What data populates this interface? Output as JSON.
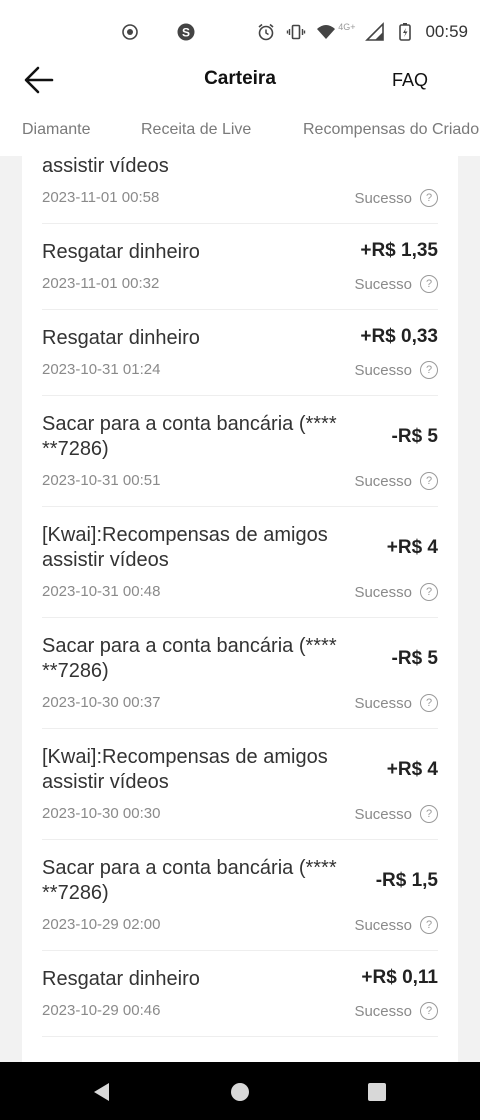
{
  "status_bar": {
    "time": "00:59",
    "network": "4G+",
    "icons": [
      "record-icon",
      "s-app-icon",
      "alarm-icon",
      "vibrate-icon",
      "wifi-icon",
      "signal-icon",
      "battery-icon"
    ]
  },
  "header": {
    "title": "Carteira",
    "faq": "FAQ"
  },
  "tabs": [
    {
      "label": "Diamante"
    },
    {
      "label": "Receita de Live"
    },
    {
      "label": "Recompensas do Criador"
    }
  ],
  "partial_top": {
    "desc": "assistir vídeos",
    "date": "2023-11-01 00:58",
    "status": "Sucesso"
  },
  "transactions": [
    {
      "desc": "Resgatar dinheiro",
      "amount": "+R$ 1,35",
      "date": "2023-11-01 00:32",
      "status": "Sucesso"
    },
    {
      "desc": "Resgatar dinheiro",
      "amount": "+R$ 0,33",
      "date": "2023-10-31 01:24",
      "status": "Sucesso"
    },
    {
      "desc": "Sacar para a conta bancária (****\n**7286)",
      "amount": "-R$ 5",
      "date": "2023-10-31 00:51",
      "status": "Sucesso"
    },
    {
      "desc": "[Kwai]:Recompensas de amigos\nassistir vídeos",
      "amount": "+R$ 4",
      "date": "2023-10-31 00:48",
      "status": "Sucesso"
    },
    {
      "desc": "Sacar para a conta bancária (****\n**7286)",
      "amount": "-R$ 5",
      "date": "2023-10-30 00:37",
      "status": "Sucesso"
    },
    {
      "desc": "[Kwai]:Recompensas de amigos\nassistir vídeos",
      "amount": "+R$ 4",
      "date": "2023-10-30 00:30",
      "status": "Sucesso"
    },
    {
      "desc": "Sacar para a conta bancária (****\n**7286)",
      "amount": "-R$ 1,5",
      "date": "2023-10-29 02:00",
      "status": "Sucesso"
    },
    {
      "desc": "Resgatar dinheiro",
      "amount": "+R$ 0,11",
      "date": "2023-10-29 00:46",
      "status": "Sucesso"
    }
  ],
  "help_glyph": "?",
  "colors": {
    "background": "#f2f2f2",
    "card": "#ffffff",
    "text": "#333333",
    "muted": "#8a8a8a",
    "nav_bar": "#000000"
  }
}
